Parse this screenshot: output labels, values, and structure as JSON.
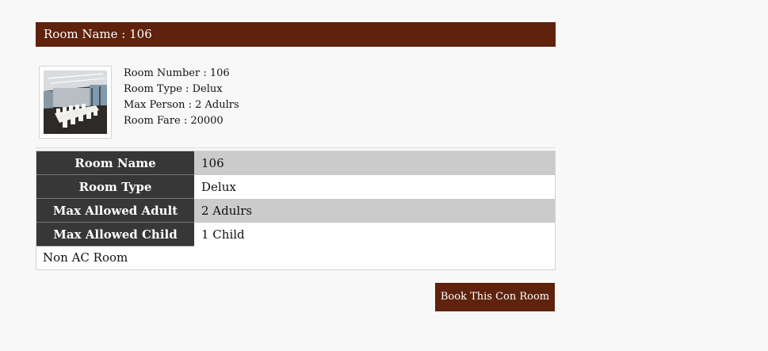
{
  "header": {
    "title": "Room Name : 106"
  },
  "summary": {
    "image_icon": "conference-room-photo",
    "room_number": "Room Number : 106",
    "room_type": "Room Type : Delux",
    "max_person": "Max Person : 2 Adulrs",
    "room_fare": "Room Fare : 20000"
  },
  "details": {
    "rows": [
      {
        "label": "Room Name",
        "value": "106"
      },
      {
        "label": "Room Type",
        "value": "Delux"
      },
      {
        "label": "Max Allowed Adult",
        "value": "2 Adulrs"
      },
      {
        "label": "Max Allowed Child",
        "value": "1 Child"
      }
    ],
    "note": "Non AC Room"
  },
  "actions": {
    "book_label": "Book This Con Room"
  },
  "colors": {
    "brand": "#5e220d",
    "label_bg": "#373737",
    "shade_row": "#cbcbcb",
    "page_bg": "#f8f8f8"
  }
}
